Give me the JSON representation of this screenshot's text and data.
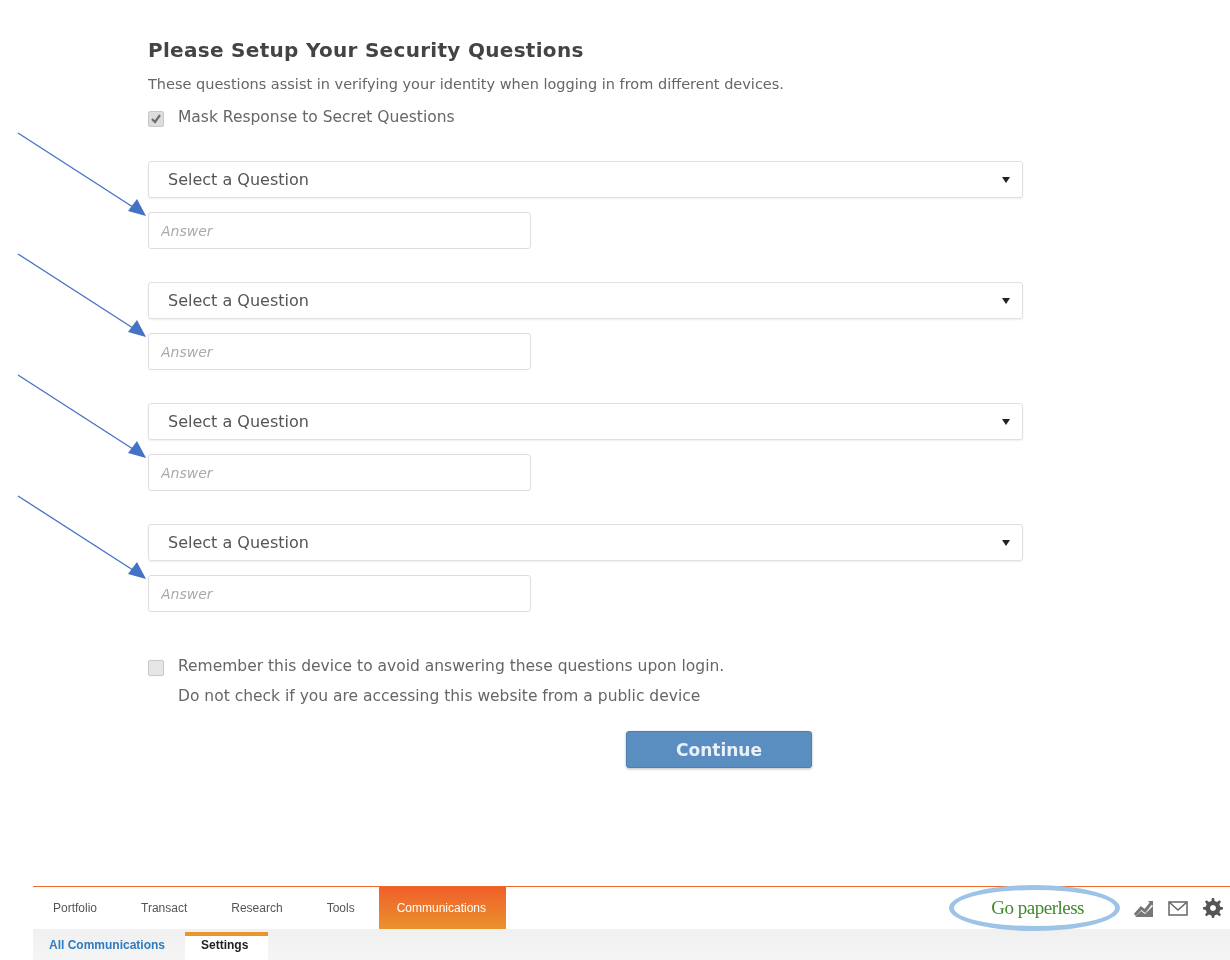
{
  "form": {
    "title": "Please Setup Your Security Questions",
    "subtitle": "These questions assist in verifying your identity when logging in from different devices.",
    "mask_option": {
      "label": "Mask Response to Secret Questions",
      "checked": true
    },
    "questions": [
      {
        "select_placeholder": "Select a Question",
        "answer_placeholder": "Answer",
        "arrow": true
      },
      {
        "select_placeholder": "Select a Question",
        "answer_placeholder": "Answer",
        "arrow": true
      },
      {
        "select_placeholder": "Select a Question",
        "answer_placeholder": "Answer",
        "arrow": true
      },
      {
        "select_placeholder": "Select a Question",
        "answer_placeholder": "Answer",
        "arrow": true
      }
    ],
    "remember_option": {
      "label": "Remember this device to avoid answering these questions upon login.",
      "note": "Do not check if you are accessing this website from a public device",
      "checked": false
    },
    "continue_button": "Continue"
  },
  "nav": {
    "tabs": [
      {
        "label": "Portfolio",
        "selected": false
      },
      {
        "label": "Transact",
        "selected": false
      },
      {
        "label": "Research",
        "selected": false
      },
      {
        "label": "Tools",
        "selected": false
      },
      {
        "label": "Communications",
        "selected": true
      }
    ],
    "go_paperless": {
      "label": "Go paperless",
      "circled": true
    },
    "subtabs": [
      {
        "label": "All Communications",
        "selected": false
      },
      {
        "label": "Settings",
        "selected": true
      }
    ]
  }
}
